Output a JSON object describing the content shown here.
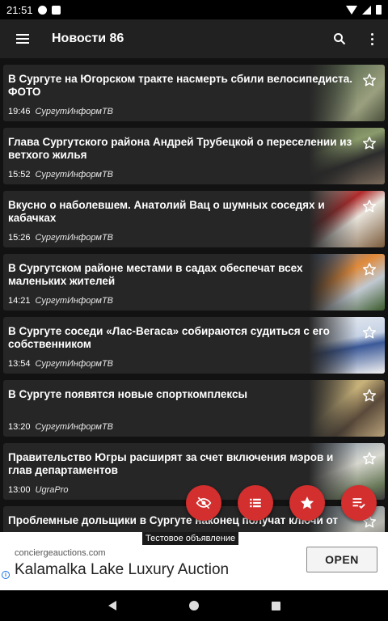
{
  "status_bar": {
    "time": "21:51"
  },
  "app_bar": {
    "title": "Новости 86"
  },
  "feed": [
    {
      "title": "В Сургуте на Югорском тракте насмерть сбили велосипедиста. ФОТО",
      "time": "19:46",
      "source": "СургутИнформТВ"
    },
    {
      "title": "Глава Сургутского района Андрей Трубецкой о переселении из ветхого жилья",
      "time": "15:52",
      "source": "СургутИнформТВ"
    },
    {
      "title": "Вкусно о наболевшем. Анатолий Вац о шумных соседях и кабачках",
      "time": "15:26",
      "source": "СургутИнформТВ"
    },
    {
      "title": "В Сургутском районе местами в садах обеспечат всех маленьких жителей",
      "time": "14:21",
      "source": "СургутИнформТВ"
    },
    {
      "title": "В Сургуте соседи «Лас-Вегаса» собираются судиться с его собственником",
      "time": "13:54",
      "source": "СургутИнформТВ"
    },
    {
      "title": "В Сургуте появятся новые спорткомплексы",
      "time": "13:20",
      "source": "СургутИнформТВ"
    },
    {
      "title": "Правительство Югры расширят за счет включения мэров и глав департаментов",
      "time": "13:00",
      "source": "UgraPro"
    },
    {
      "title": "Проблемные дольщики в Сургуте наконец получат ключи от",
      "time": "",
      "source": ""
    }
  ],
  "fabs": [
    "hide-read-icon",
    "list-icon",
    "star-icon",
    "mark-read-icon"
  ],
  "ad": {
    "label": "Тестовое объявление",
    "domain": "conciergeauctions.com",
    "headline": "Kalamalka Lake Luxury Auction",
    "cta": "OPEN"
  },
  "colors": {
    "app_bar": "#212121",
    "card": "#262626",
    "fab": "#d32f2f",
    "background": "#121212"
  }
}
